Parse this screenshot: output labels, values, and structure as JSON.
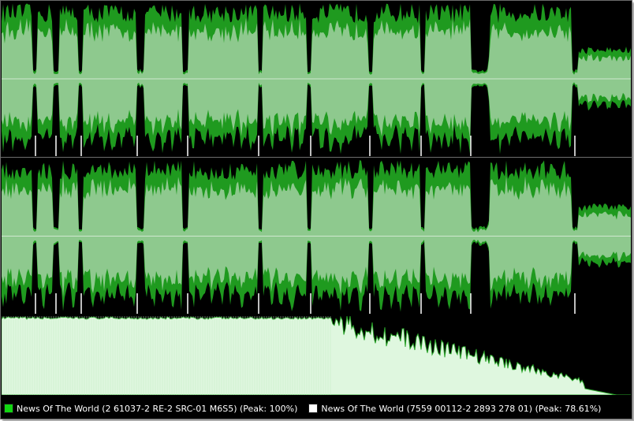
{
  "colors": {
    "background": "#000000",
    "wave_outer": "#1f9a1f",
    "wave_inner": "#8ec98e",
    "center_line": "#cfe8cf",
    "spectrum_fill": "#dff7df",
    "spectrum_edge": "#2aa52a",
    "track1_swatch": "#11d611",
    "track2_swatch": "#ffffff"
  },
  "legend": {
    "track1": "News Of The World (2 61037-2 RE-2 SRC-01 M6S5) (Peak: 100%)",
    "track2": "News Of The World (7559 00112-2 2893 278 01) (Peak: 78.61%)"
  },
  "track_boundaries_fraction": [
    0.054,
    0.087,
    0.127,
    0.216,
    0.296,
    0.408,
    0.491,
    0.585,
    0.667,
    0.745,
    0.911
  ]
}
